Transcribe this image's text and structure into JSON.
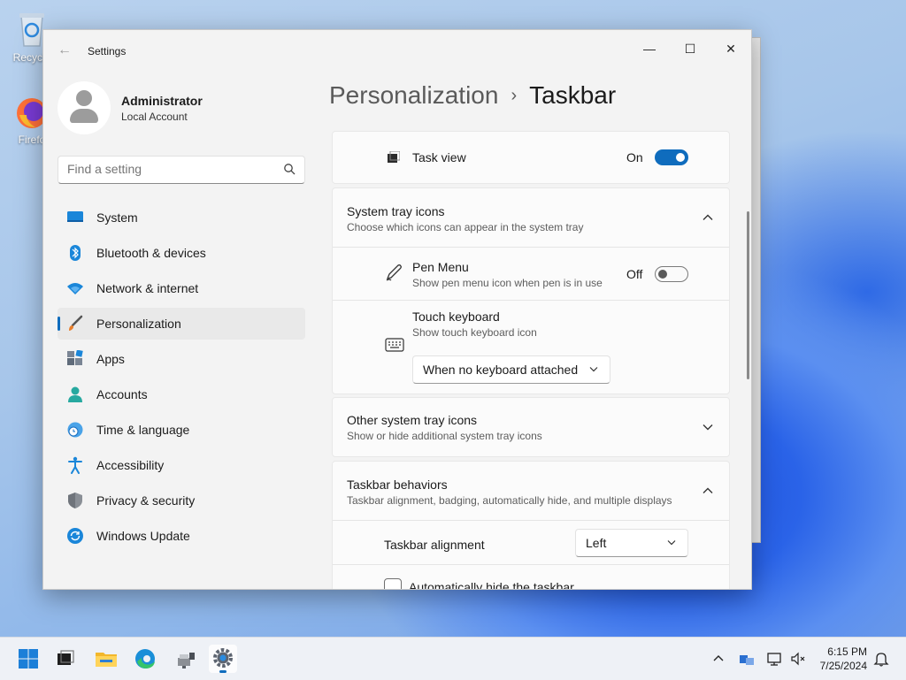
{
  "desktop": {
    "icons": [
      {
        "label": "Recycle"
      },
      {
        "label": "Firefo"
      }
    ]
  },
  "window": {
    "title": "Settings",
    "controls": {
      "minimize": "—",
      "maximize": "☐",
      "close": "✕"
    }
  },
  "profile": {
    "name": "Administrator",
    "subtitle": "Local Account"
  },
  "search": {
    "placeholder": "Find a setting"
  },
  "nav": {
    "items": [
      {
        "label": "System",
        "icon": "monitor-icon"
      },
      {
        "label": "Bluetooth & devices",
        "icon": "bluetooth-icon"
      },
      {
        "label": "Network & internet",
        "icon": "wifi-icon"
      },
      {
        "label": "Personalization",
        "icon": "brush-icon",
        "active": true
      },
      {
        "label": "Apps",
        "icon": "apps-icon"
      },
      {
        "label": "Accounts",
        "icon": "person-icon"
      },
      {
        "label": "Time & language",
        "icon": "globe-clock-icon"
      },
      {
        "label": "Accessibility",
        "icon": "accessibility-icon"
      },
      {
        "label": "Privacy & security",
        "icon": "shield-icon"
      },
      {
        "label": "Windows Update",
        "icon": "update-icon"
      }
    ]
  },
  "breadcrumb": {
    "parent": "Personalization",
    "separator": "›",
    "current": "Taskbar"
  },
  "content": {
    "task_view": {
      "label": "Task view",
      "state": "On",
      "enabled": true
    },
    "system_tray": {
      "title": "System tray icons",
      "subtitle": "Choose which icons can appear in the system tray",
      "pen_menu": {
        "title": "Pen Menu",
        "subtitle": "Show pen menu icon when pen is in use",
        "state": "Off",
        "enabled": false
      },
      "touch_keyboard": {
        "title": "Touch keyboard",
        "subtitle": "Show touch keyboard icon",
        "dropdown": "When no keyboard attached"
      }
    },
    "other_tray": {
      "title": "Other system tray icons",
      "subtitle": "Show or hide additional system tray icons"
    },
    "behaviors": {
      "title": "Taskbar behaviors",
      "subtitle": "Taskbar alignment, badging, automatically hide, and multiple displays",
      "alignment": {
        "label": "Taskbar alignment",
        "value": "Left"
      },
      "auto_hide": {
        "label": "Automatically hide the taskbar",
        "checked": false
      }
    }
  },
  "taskbar": {
    "clock": {
      "time": "6:15 PM",
      "date": "7/25/2024"
    },
    "apps": [
      "start-icon",
      "task-view-icon",
      "file-explorer-icon",
      "edge-icon",
      "network-app-icon",
      "settings-icon"
    ]
  },
  "colors": {
    "accent": "#0f6cbd"
  }
}
